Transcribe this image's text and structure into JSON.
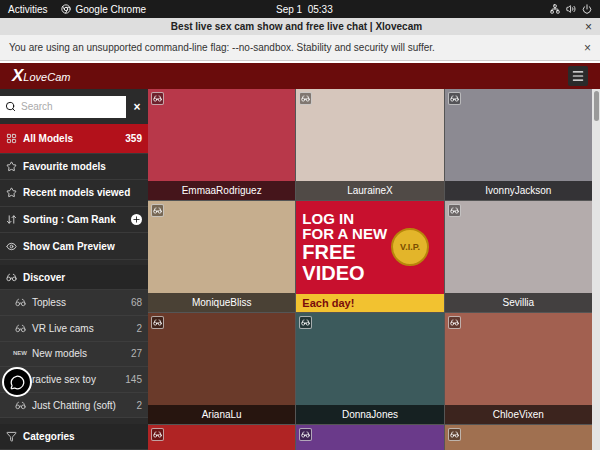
{
  "system_bar": {
    "activities": "Activities",
    "app": "Google Chrome",
    "clock": "Sep 1  05:33"
  },
  "window": {
    "title": "Best live sex cam show and free live chat | Xlovecam",
    "close": "×"
  },
  "infobar": {
    "message": "You are using an unsupported command-line flag: --no-sandbox. Stability and security will suffer.",
    "close": "×"
  },
  "site_header": {
    "logo_mark": "X",
    "logo_text": "LoveCam"
  },
  "sidebar": {
    "search": {
      "placeholder": "Search",
      "clear": "×"
    },
    "items": [
      {
        "label": "All Models",
        "count": "359",
        "kind": "main",
        "selected": true
      },
      {
        "label": "Favourite models",
        "kind": "main",
        "selected": false
      },
      {
        "label": "Recent models viewed",
        "kind": "main",
        "selected": false
      },
      {
        "label": "Sorting : Cam Rank",
        "kind": "main",
        "selected": false
      },
      {
        "label": "Show Cam Preview",
        "kind": "main",
        "selected": false
      },
      {
        "label": "Discover",
        "kind": "header",
        "selected": false
      },
      {
        "label": "Topless",
        "count": "68",
        "kind": "sub",
        "selected": false
      },
      {
        "label": "VR Live cams",
        "count": "2",
        "kind": "sub",
        "selected": false
      },
      {
        "label": "New models",
        "count": "27",
        "kind": "sub",
        "badge": "NEW",
        "selected": false
      },
      {
        "label": "ractive sex toy",
        "count": "145",
        "kind": "sub",
        "selected": false
      },
      {
        "label": "Just Chatting (soft)",
        "count": "2",
        "kind": "sub",
        "selected": false
      },
      {
        "label": "Categories",
        "kind": "header",
        "selected": false
      }
    ]
  },
  "grid": {
    "cards": [
      {
        "kind": "model",
        "name": "EmmaaRodriguez",
        "color": "#b8384a"
      },
      {
        "kind": "model",
        "name": "LauraineX",
        "color": "#d6c6bc"
      },
      {
        "kind": "model",
        "name": "IvonnyJackson",
        "color": "#8c8a92"
      },
      {
        "kind": "model",
        "name": "MoniqueBliss",
        "color": "#c6ae8e"
      },
      {
        "kind": "ad",
        "lines": [
          "LOG IN",
          "FOR A NEW",
          "FREE",
          "VIDEO"
        ],
        "footer": "Each day!",
        "coin": "V.I.P.",
        "color": "#c8102e"
      },
      {
        "kind": "model",
        "name": "Sevillia",
        "color": "#b4acac"
      },
      {
        "kind": "model",
        "name": "ArianaLu",
        "color": "#6a3a2a"
      },
      {
        "kind": "model",
        "name": "DonnaJones",
        "color": "#3c5a5c"
      },
      {
        "kind": "model",
        "name": "ChloeVixen",
        "color": "#a26050"
      },
      {
        "kind": "model",
        "color": "#b02424"
      },
      {
        "kind": "model",
        "color": "#6a3a8a"
      },
      {
        "kind": "model",
        "color": "#a07050"
      }
    ]
  }
}
